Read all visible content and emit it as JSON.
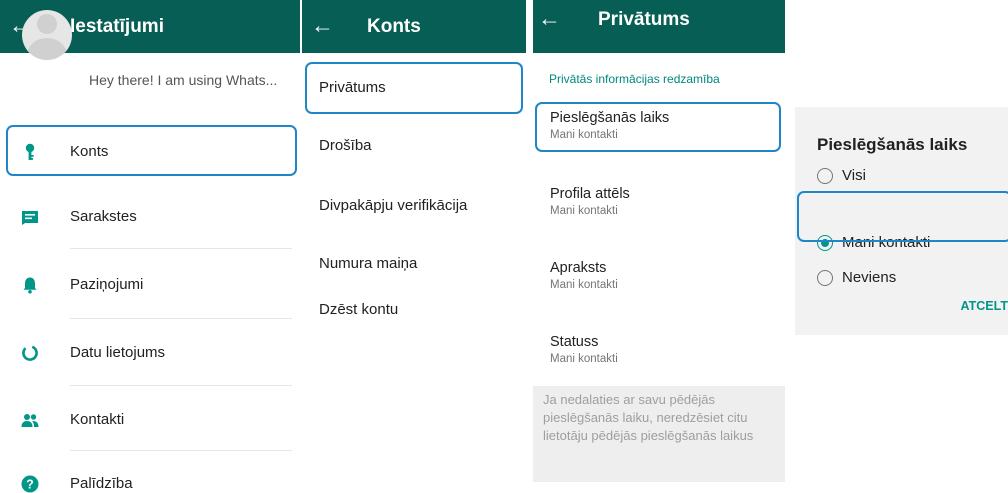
{
  "colors": {
    "appbar": "#075e54",
    "accent": "#009688",
    "highlight": "#1f86c8",
    "section": "#00897b"
  },
  "settings": {
    "title": "Iestatījumi",
    "back_icon": "arrow-left-icon",
    "profile_status": "Hey there! I am using Whats...",
    "items": [
      {
        "label": "Konts",
        "icon": "key-icon"
      },
      {
        "label": "Sarakstes",
        "icon": "chat-icon"
      },
      {
        "label": "Paziņojumi",
        "icon": "bell-icon"
      },
      {
        "label": "Datu lietojums",
        "icon": "data-usage-icon"
      },
      {
        "label": "Kontakti",
        "icon": "contacts-icon"
      },
      {
        "label": "Palīdzība",
        "icon": "help-icon"
      }
    ]
  },
  "account": {
    "title": "Konts",
    "back_icon": "arrow-left-icon",
    "items": [
      {
        "label": "Privātums"
      },
      {
        "label": "Drošība"
      },
      {
        "label": "Divpakāpju verifikācija"
      },
      {
        "label": "Numura maiņa"
      },
      {
        "label": "Dzēst kontu"
      }
    ]
  },
  "privacy": {
    "title": "Privātums",
    "back_icon": "arrow-left-icon",
    "section_header": "Privātās informācijas redzamība",
    "items": [
      {
        "label": "Pieslēgšanās laiks",
        "value": "Mani kontakti"
      },
      {
        "label": "Profila attēls",
        "value": "Mani kontakti"
      },
      {
        "label": "Apraksts",
        "value": "Mani kontakti"
      },
      {
        "label": "Statuss",
        "value": "Mani kontakti"
      }
    ],
    "footer_note": "Ja nedalaties ar savu pēdējās pieslēgšanās laiku, neredzēsiet citu lietotāju pēdējās pieslēgšanās laikus"
  },
  "dialog": {
    "title": "Pieslēgšanās laiks",
    "options": [
      {
        "label": "Visi",
        "selected": false
      },
      {
        "label": "Mani kontakti",
        "selected": true
      },
      {
        "label": "Neviens",
        "selected": false
      }
    ],
    "cancel_label": "ATCELT"
  }
}
